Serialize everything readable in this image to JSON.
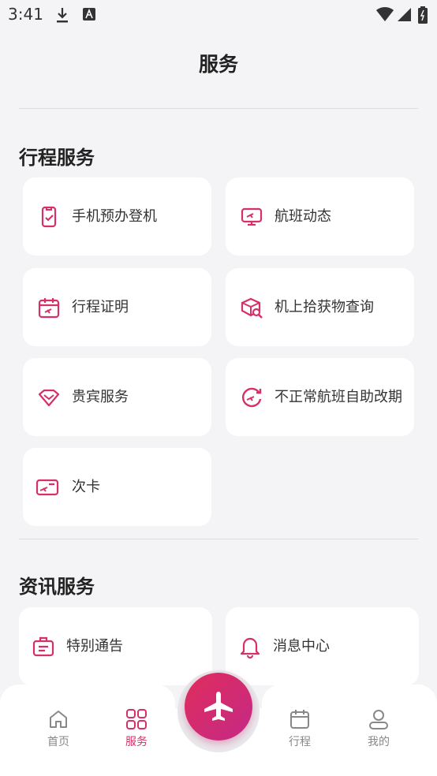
{
  "status_bar": {
    "time": "3:41"
  },
  "page": {
    "title": "服务"
  },
  "sections": [
    {
      "title": "行程服务",
      "items": [
        {
          "label": "手机预办登机",
          "icon": "mobile-checkin-icon"
        },
        {
          "label": "航班动态",
          "icon": "flight-status-icon"
        },
        {
          "label": "行程证明",
          "icon": "itinerary-calendar-icon"
        },
        {
          "label": "机上拾获物查询",
          "icon": "lost-found-icon"
        },
        {
          "label": "贵宾服务",
          "icon": "vip-diamond-icon"
        },
        {
          "label": "不正常航班自助改期",
          "icon": "reschedule-icon"
        },
        {
          "label": "次卡",
          "icon": "pass-card-icon"
        }
      ]
    },
    {
      "title": "资讯服务",
      "items": [
        {
          "label": "特别通告",
          "icon": "notice-briefcase-icon"
        },
        {
          "label": "消息中心",
          "icon": "bell-icon"
        }
      ]
    }
  ],
  "bottom_nav": {
    "items": [
      {
        "label": "首页",
        "icon": "home-icon",
        "active": false
      },
      {
        "label": "服务",
        "icon": "grid-icon",
        "active": true
      },
      {
        "label": "行程",
        "icon": "calendar-icon",
        "active": false
      },
      {
        "label": "我的",
        "icon": "profile-icon",
        "active": false
      }
    ],
    "center_button_icon": "airplane-icon"
  },
  "colors": {
    "accent": "#d6306b",
    "accent_dark": "#c42a86",
    "background": "#f4f4f6"
  }
}
